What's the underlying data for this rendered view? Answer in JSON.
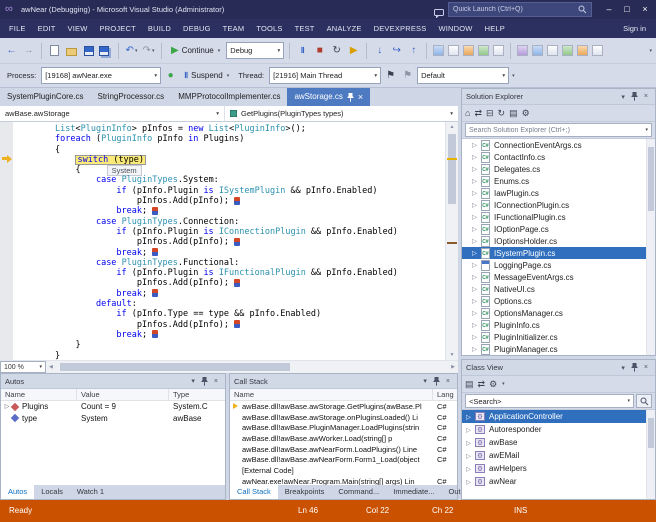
{
  "colors": {
    "titlebar_bg": "#272B55",
    "menubar_bg": "#2C3060",
    "toolbar_bg": "#D6DBE9",
    "dock_bg": "#CFD6E5",
    "statusbar_bg": "#CA5100",
    "active_tab_bg": "#4D7AC1",
    "selection_bg": "#2F6FBE",
    "keyword": "#0000EE",
    "type_name": "#2B91AF",
    "current_stmt_bg": "#FBEA77",
    "editor_bg": "#FFFFFF"
  },
  "window": {
    "title": "awNear (Debugging) - Microsoft Visual Studio (Administrator)",
    "quick_launch_placeholder": "Quick Launch (Ctrl+Q)"
  },
  "menu": {
    "items": [
      "FILE",
      "EDIT",
      "VIEW",
      "PROJECT",
      "BUILD",
      "DEBUG",
      "TEAM",
      "TOOLS",
      "TEST",
      "ANALYZE",
      "DEVEXPRESS",
      "WINDOW",
      "HELP"
    ],
    "sign_in": "Sign in"
  },
  "toolbar1": {
    "continue_label": "Continue",
    "config_value": "Debug"
  },
  "toolbar2": {
    "process_label": "Process:",
    "process_value": "[19168] awNear.exe",
    "suspend_label": "Suspend",
    "thread_label": "Thread:",
    "thread_value": "[21916] Main Thread",
    "frame_value": "Default"
  },
  "doc_tabs": [
    {
      "label": "SystemPluginCore.cs",
      "active": false
    },
    {
      "label": "StringProcessor.cs",
      "active": false
    },
    {
      "label": "MMPProtocolImplementer.cs",
      "active": false
    },
    {
      "label": "awStorage.cs",
      "active": true
    }
  ],
  "navbar": {
    "scope": "awBase.awStorage",
    "member": "GetPlugins(PluginTypes types)"
  },
  "editor": {
    "zoom": "100 %",
    "datatip_value": "System",
    "lines": [
      {
        "i": 0,
        "seg": [
          [
            "t",
            "List"
          ],
          [
            "p",
            "<"
          ],
          [
            "t",
            "PluginInfo"
          ],
          [
            "p",
            "> pInfos = "
          ],
          [
            "k",
            "new"
          ],
          [
            "p",
            " "
          ],
          [
            "t",
            "List"
          ],
          [
            "p",
            "<"
          ],
          [
            "t",
            "PluginInfo"
          ],
          [
            "p",
            ">();"
          ]
        ]
      },
      {
        "i": 0,
        "seg": [
          [
            "k",
            "foreach"
          ],
          [
            "p",
            " ("
          ],
          [
            "t",
            "PluginInfo"
          ],
          [
            "p",
            " pInfo "
          ],
          [
            "k",
            "in"
          ],
          [
            "p",
            " Plugins)"
          ]
        ]
      },
      {
        "i": 0,
        "seg": [
          [
            "p",
            "{"
          ]
        ]
      },
      {
        "i": 1,
        "cur": true,
        "seg": [
          [
            "k",
            "switch"
          ],
          [
            "p",
            " (type)"
          ]
        ]
      },
      {
        "i": 1,
        "tip": true,
        "seg": [
          [
            "p",
            "{"
          ]
        ]
      },
      {
        "i": 2,
        "seg": [
          [
            "k",
            "case"
          ],
          [
            "p",
            " "
          ],
          [
            "t",
            "PluginTypes"
          ],
          [
            "p",
            ".System:"
          ]
        ]
      },
      {
        "i": 3,
        "seg": [
          [
            "k",
            "if"
          ],
          [
            "p",
            " (pInfo.Plugin "
          ],
          [
            "k",
            "is"
          ],
          [
            "p",
            " "
          ],
          [
            "t",
            "ISystemPlugin"
          ],
          [
            "p",
            " && pInfo.Enabled)"
          ]
        ]
      },
      {
        "i": 4,
        "mark": true,
        "seg": [
          [
            "p",
            "pInfos.Add(pInfo);"
          ]
        ]
      },
      {
        "i": 3,
        "mark": true,
        "seg": [
          [
            "k",
            "break"
          ],
          [
            "p",
            ";"
          ]
        ]
      },
      {
        "i": 2,
        "seg": [
          [
            "k",
            "case"
          ],
          [
            "p",
            " "
          ],
          [
            "t",
            "PluginTypes"
          ],
          [
            "p",
            ".Connection:"
          ]
        ]
      },
      {
        "i": 3,
        "seg": [
          [
            "k",
            "if"
          ],
          [
            "p",
            " (pInfo.Plugin "
          ],
          [
            "k",
            "is"
          ],
          [
            "p",
            " "
          ],
          [
            "t",
            "IConnectionPlugin"
          ],
          [
            "p",
            " && pInfo.Enabled)"
          ]
        ]
      },
      {
        "i": 4,
        "mark": true,
        "seg": [
          [
            "p",
            "pInfos.Add(pInfo);"
          ]
        ]
      },
      {
        "i": 3,
        "mark": true,
        "seg": [
          [
            "k",
            "break"
          ],
          [
            "p",
            ";"
          ]
        ]
      },
      {
        "i": 2,
        "seg": [
          [
            "k",
            "case"
          ],
          [
            "p",
            " "
          ],
          [
            "t",
            "PluginTypes"
          ],
          [
            "p",
            ".Functional:"
          ]
        ]
      },
      {
        "i": 3,
        "seg": [
          [
            "k",
            "if"
          ],
          [
            "p",
            " (pInfo.Plugin "
          ],
          [
            "k",
            "is"
          ],
          [
            "p",
            " "
          ],
          [
            "t",
            "IFunctionalPlugin"
          ],
          [
            "p",
            " && pInfo.Enabled)"
          ]
        ]
      },
      {
        "i": 4,
        "mark": true,
        "seg": [
          [
            "p",
            "pInfos.Add(pInfo);"
          ]
        ]
      },
      {
        "i": 3,
        "mark": true,
        "seg": [
          [
            "k",
            "break"
          ],
          [
            "p",
            ";"
          ]
        ]
      },
      {
        "i": 2,
        "seg": [
          [
            "k",
            "default"
          ],
          [
            "p",
            ":"
          ]
        ]
      },
      {
        "i": 3,
        "seg": [
          [
            "k",
            "if"
          ],
          [
            "p",
            " (pInfo.Type == type && pInfo.Enabled)"
          ]
        ]
      },
      {
        "i": 4,
        "mark": true,
        "seg": [
          [
            "p",
            "pInfos.Add(pInfo);"
          ]
        ]
      },
      {
        "i": 3,
        "mark": true,
        "seg": [
          [
            "k",
            "break"
          ],
          [
            "p",
            ";"
          ]
        ]
      },
      {
        "i": 1,
        "seg": [
          [
            "p",
            "}"
          ]
        ]
      },
      {
        "i": 0,
        "seg": [
          [
            "p",
            "}"
          ]
        ]
      }
    ]
  },
  "autos": {
    "title": "Autos",
    "columns": [
      "Name",
      "Value",
      "Type"
    ],
    "rows": [
      {
        "name": "Plugins",
        "value": "Count = 9",
        "type": "System.C",
        "expandable": true,
        "icon": "field"
      },
      {
        "name": "type",
        "value": "System",
        "type": "awBase",
        "expandable": false,
        "icon": "enum"
      }
    ],
    "tabs": [
      {
        "label": "Autos",
        "active": true
      },
      {
        "label": "Locals",
        "active": false
      },
      {
        "label": "Watch 1",
        "active": false
      }
    ]
  },
  "callstack": {
    "title": "Call Stack",
    "columns": [
      "Name",
      "Lang"
    ],
    "rows": [
      {
        "text": "awBase.dll!awBase.awStorage.GetPlugins(awBase.Pl",
        "lang": "C#",
        "current": true
      },
      {
        "text": "awBase.dll!awBase.awStorage.onPluginsLoaded() Li",
        "lang": "C#",
        "current": false
      },
      {
        "text": "awBase.dll!awBase.PluginManager.LoadPlugins(strin",
        "lang": "C#",
        "current": false
      },
      {
        "text": "awBase.dll!awBase.awWorker.Load(string[] p",
        "lang": "C#",
        "current": false
      },
      {
        "text": "awBase.dll!awBase.awNearForm.LoadPlugins() Line",
        "lang": "C#",
        "current": false
      },
      {
        "text": "awBase.dll!awBase.awNearForm.Form1_Load(object",
        "lang": "C#",
        "current": false
      },
      {
        "text": "[External Code]",
        "lang": "",
        "current": false
      },
      {
        "text": "awNear.exe!awNear.Program.Main(string[] args) Lin",
        "lang": "C#",
        "current": false
      }
    ],
    "tabs": [
      {
        "label": "Call Stack",
        "active": true
      },
      {
        "label": "Breakpoints",
        "active": false
      },
      {
        "label": "Command...",
        "active": false
      },
      {
        "label": "Immediate...",
        "active": false
      },
      {
        "label": "Output",
        "active": false
      }
    ]
  },
  "solution_explorer": {
    "title": "Solution Explorer",
    "search_placeholder": "Search Solution Explorer (Ctrl+;)",
    "items": [
      {
        "label": "ConnectionEventArgs.cs",
        "selected": false,
        "icon": "csharp"
      },
      {
        "label": "ContactInfo.cs",
        "selected": false,
        "icon": "csharp"
      },
      {
        "label": "Delegates.cs",
        "selected": false,
        "icon": "csharp"
      },
      {
        "label": "Enums.cs",
        "selected": false,
        "icon": "csharp"
      },
      {
        "label": "IawPlugin.cs",
        "selected": false,
        "icon": "csharp"
      },
      {
        "label": "IConnectionPlugin.cs",
        "selected": false,
        "icon": "csharp"
      },
      {
        "label": "IFunctionalPlugin.cs",
        "selected": false,
        "icon": "csharp"
      },
      {
        "label": "IOptionPage.cs",
        "selected": false,
        "icon": "csharp"
      },
      {
        "label": "IOptionsHolder.cs",
        "selected": false,
        "icon": "csharp"
      },
      {
        "label": "ISystemPlugin.cs",
        "selected": true,
        "icon": "csharp"
      },
      {
        "label": "LoggingPage.cs",
        "selected": false,
        "icon": "form"
      },
      {
        "label": "MessageEventArgs.cs",
        "selected": false,
        "icon": "csharp"
      },
      {
        "label": "NativeUI.cs",
        "selected": false,
        "icon": "csharp"
      },
      {
        "label": "Options.cs",
        "selected": false,
        "icon": "csharp"
      },
      {
        "label": "OptionsManager.cs",
        "selected": false,
        "icon": "csharp"
      },
      {
        "label": "PluginInfo.cs",
        "selected": false,
        "icon": "csharp"
      },
      {
        "label": "PluginInitializer.cs",
        "selected": false,
        "icon": "csharp"
      },
      {
        "label": "PluginManager.cs",
        "selected": false,
        "icon": "csharp"
      }
    ]
  },
  "class_view": {
    "title": "Class View",
    "search_value": "<Search>",
    "items": [
      {
        "label": "ApplicationController",
        "selected": true
      },
      {
        "label": "Autoresponder",
        "selected": false
      },
      {
        "label": "awBase",
        "selected": false
      },
      {
        "label": "awEMail",
        "selected": false
      },
      {
        "label": "awHelpers",
        "selected": false
      },
      {
        "label": "awNear",
        "selected": false
      }
    ]
  },
  "icon_glyphs": {
    "csharp_badge": "C#",
    "assembly_badge": "{}"
  },
  "statusbar": {
    "state": "Ready",
    "line": "Ln 46",
    "column": "Col 22",
    "character": "Ch 22",
    "mode": "INS"
  }
}
